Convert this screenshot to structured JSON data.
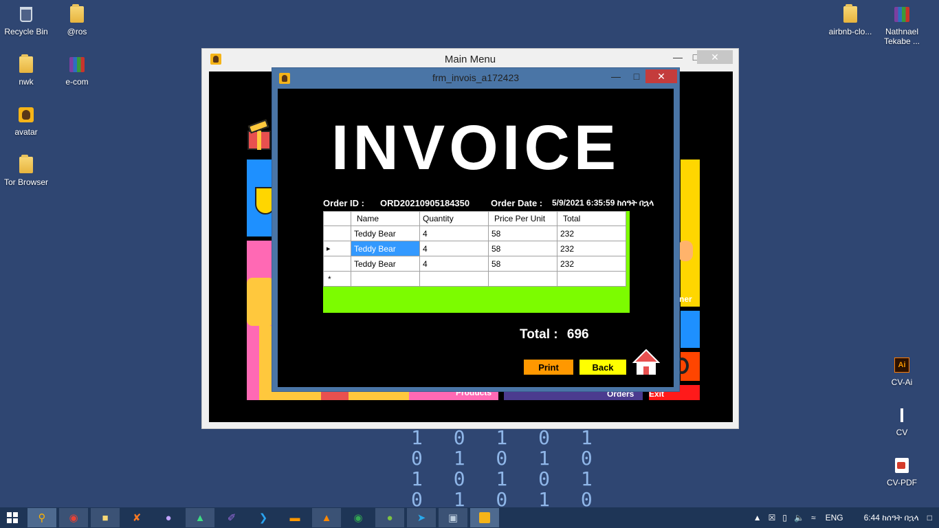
{
  "desktop_icons": [
    {
      "label": "Recycle Bin",
      "icon": "recycle-bin-icon"
    },
    {
      "label": "@ros",
      "icon": "folder-icon"
    },
    {
      "label": "nwk",
      "icon": "folder-icon"
    },
    {
      "label": "e-com",
      "icon": "winrar-archive-icon"
    },
    {
      "label": "avatar",
      "icon": "avatar-image-icon"
    },
    {
      "label": "Tor Browser",
      "icon": "folder-icon"
    },
    {
      "label": "airbnb-clo...",
      "icon": "folder-icon"
    },
    {
      "label": "Nathnael Tekabe ...",
      "icon": "winrar-archive-icon"
    },
    {
      "label": "CV-Ai",
      "icon": "illustrator-file-icon"
    },
    {
      "label": "CV",
      "icon": "document-icon"
    },
    {
      "label": "CV-PDF",
      "icon": "pdf-file-icon"
    }
  ],
  "binary_rows": [
    "1 0 1 0 1",
    "0 1 0 1 0",
    "1 0 1 0 1",
    "0 1 0 1 0"
  ],
  "main_window": {
    "title": "Main Menu",
    "tiles": {
      "customer_label": "ner",
      "products_label": "Products",
      "orders_label": "Orders",
      "exit_label": "Exit"
    }
  },
  "invoice_window": {
    "title": "frm_invois_a172423",
    "heading": "INVOICE",
    "order_id_label": "Order ID :",
    "order_id": "ORD20210905184350",
    "order_date_label": "Order Date :",
    "order_date": "5/9/2021 6:35:59 ከሰዓት በኋላ",
    "grid": {
      "columns": [
        "Name",
        "Quantity",
        "Price Per Unit",
        "Total"
      ],
      "rows": [
        {
          "name": "Teddy Bear",
          "quantity": "4",
          "price": "58",
          "total": "232"
        },
        {
          "name": "Teddy Bear",
          "quantity": "4",
          "price": "58",
          "total": "232"
        },
        {
          "name": "Teddy Bear",
          "quantity": "4",
          "price": "58",
          "total": "232"
        }
      ],
      "new_row_marker": "*",
      "current_row_marker": "▸"
    },
    "total_label": "Total :",
    "total_value": "696",
    "print_label": "Print",
    "back_label": "Back"
  },
  "taskbar": {
    "tray_language": "ENG",
    "tray_time": "6:44 ከሰዓት በኋላ"
  },
  "colors": {
    "desktop": "#2f4672",
    "grid_background": "#7cfc00",
    "print_button": "#ff9800",
    "back_button": "#ffff00",
    "selected_cell": "#3399ff"
  }
}
